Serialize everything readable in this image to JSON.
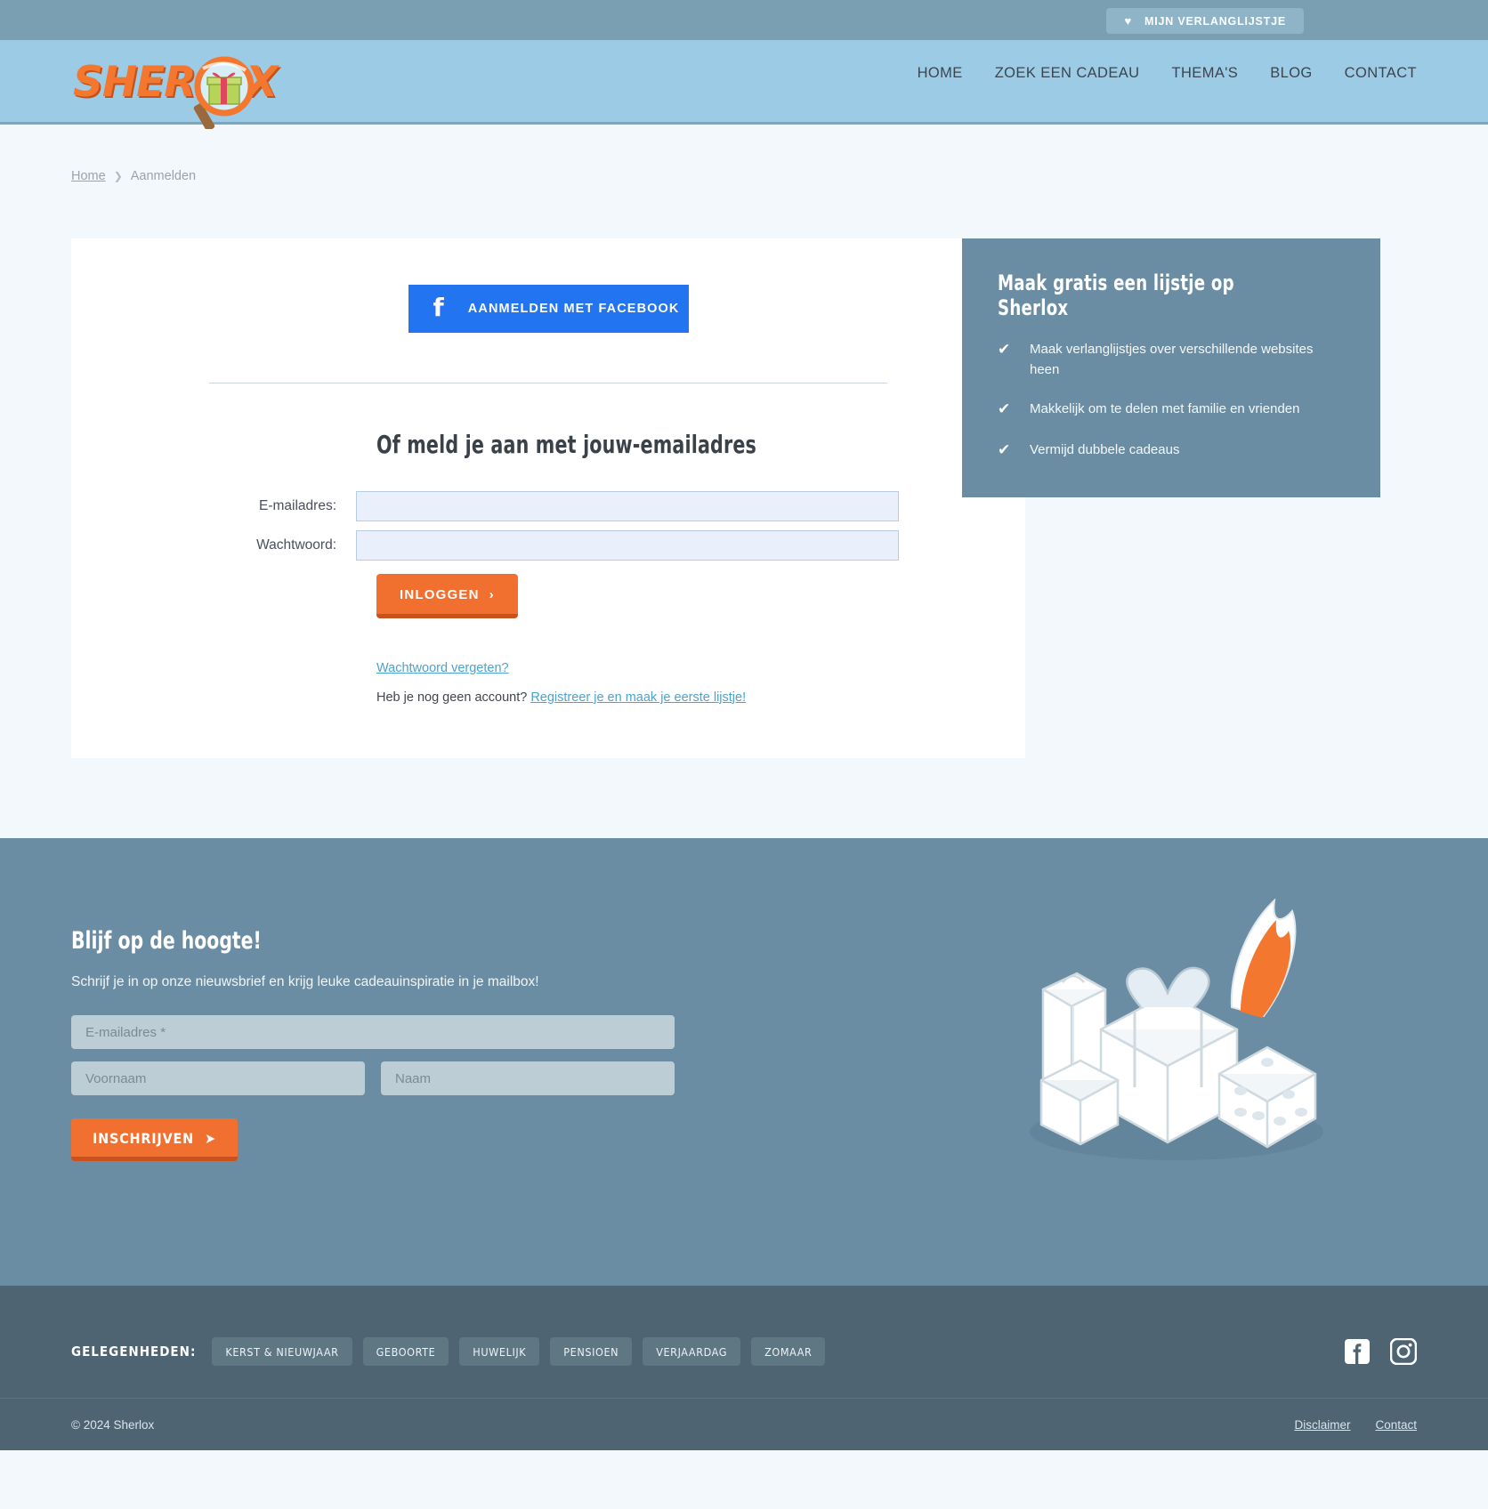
{
  "topbar": {
    "wishlist_label": "MIJN VERLANGLIJSTJE",
    "heart_icon": "♥"
  },
  "header": {
    "logo_text": "SHERLOX",
    "nav": [
      {
        "label": "HOME"
      },
      {
        "label": "ZOEK EEN CADEAU"
      },
      {
        "label": "THEMA'S"
      },
      {
        "label": "BLOG"
      },
      {
        "label": "CONTACT"
      }
    ]
  },
  "breadcrumb": {
    "home": "Home",
    "separator": "❯",
    "current": "Aanmelden"
  },
  "login": {
    "facebook_button": "AANMELDEN MET FACEBOOK",
    "facebook_icon": "f",
    "form_title": "Of meld je aan met jouw-emailadres",
    "email_label": "E-mailadres:",
    "email_value": "",
    "password_label": "Wachtwoord:",
    "password_value": "",
    "submit_label": "INLOGGEN",
    "submit_chevron": "›",
    "forgot_password": "Wachtwoord vergeten?",
    "no_account_text": "Heb je nog geen account? ",
    "register_link": "Registreer je en maak je eerste lijstje!"
  },
  "promo": {
    "title": "Maak gratis een lijstje op Sherlox",
    "check_icon": "✔",
    "items": [
      {
        "text": "Maak verlanglijstjes over verschillende websites heen"
      },
      {
        "text": "Makkelijk om te delen met familie en vrienden"
      },
      {
        "text": "Vermijd dubbele cadeaus"
      }
    ]
  },
  "newsletter": {
    "title": "Blijf op de hoogte!",
    "subtitle": "Schrijf je in op onze nieuwsbrief en krijg leuke cadeauinspiratie in je mailbox!",
    "email_placeholder": "E-mailadres *",
    "email_value": "",
    "firstname_placeholder": "Voornaam",
    "firstname_value": "",
    "lastname_placeholder": "Naam",
    "lastname_value": "",
    "submit_label": "INSCHRIJVEN",
    "submit_icon": "➤"
  },
  "footer": {
    "occasions_label": "GELEGENHEDEN:",
    "tags": [
      {
        "label": "KERST & NIEUWJAAR"
      },
      {
        "label": "GEBOORTE"
      },
      {
        "label": "HUWELIJK"
      },
      {
        "label": "PENSIOEN"
      },
      {
        "label": "VERJAARDAG"
      },
      {
        "label": "ZOMAAR"
      }
    ],
    "socials": [
      {
        "name": "facebook-icon"
      },
      {
        "name": "instagram-icon"
      }
    ],
    "copyright": "© 2024 Sherlox",
    "links": [
      {
        "label": "Disclaimer"
      },
      {
        "label": "Contact"
      }
    ]
  },
  "colors": {
    "topbar": "#7a9eb2",
    "header": "#9ccbe5",
    "accent_orange": "#f1702f",
    "accent_orange_dark": "#c9521c",
    "facebook_blue": "#2374f0",
    "promo_bg": "#6b8da3",
    "footer_bg": "#4e6472",
    "link_blue": "#4ba3cf",
    "page_bg": "#f2f8fc"
  }
}
